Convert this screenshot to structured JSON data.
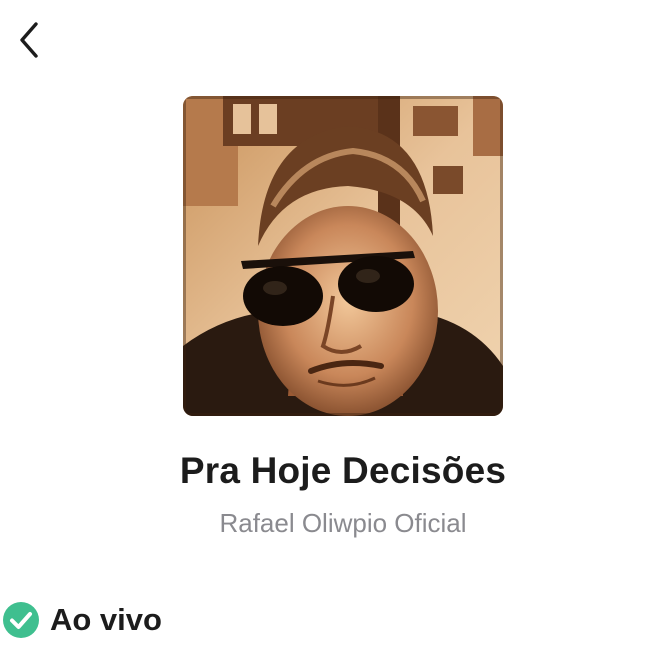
{
  "header": {
    "back_icon": "chevron-left-icon"
  },
  "album": {
    "cover_description_icon": "album-cover-image",
    "title": "Pra Hoje Decisões",
    "artist": "Rafael Oliwpio Oficial"
  },
  "status": {
    "icon": "check-circle-icon",
    "label": "Ao vivo",
    "color": "#3fbf8f"
  }
}
